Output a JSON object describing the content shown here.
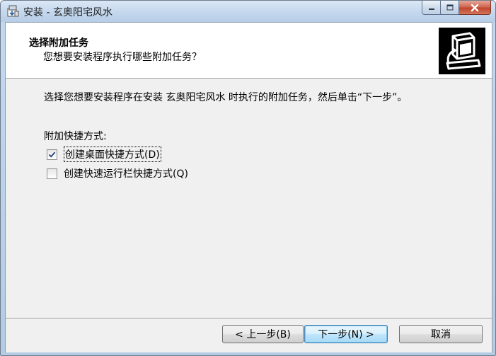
{
  "window": {
    "title": "安装 - 玄奥阳宅风水",
    "app_icon": "installer-icon",
    "caption": {
      "minimize_icon": "minimize-icon",
      "maximize_icon": "maximize-icon",
      "close_icon": "close-icon"
    }
  },
  "header": {
    "title": "选择附加任务",
    "subtitle": "您想要安装程序执行哪些附加任务？",
    "image_icon": "computer-install-icon"
  },
  "body": {
    "description": "选择您想要安装程序在安装 玄奥阳宅风水 时执行的附加任务，然后单击“下一步”。",
    "group_label": "附加快捷方式:",
    "tasks": [
      {
        "label": "创建桌面快捷方式(D)",
        "checked": true
      },
      {
        "label": "创建快速运行栏快捷方式(Q)",
        "checked": false
      }
    ]
  },
  "footer": {
    "back_label": "< 上一步(B)",
    "next_label": "下一步(N) >",
    "cancel_label": "取消"
  },
  "colors": {
    "title_bar": "#c6d9ee",
    "client_background": "#f0f0f0",
    "header_background": "#ffffff",
    "default_button_border": "#3c7fb1"
  }
}
